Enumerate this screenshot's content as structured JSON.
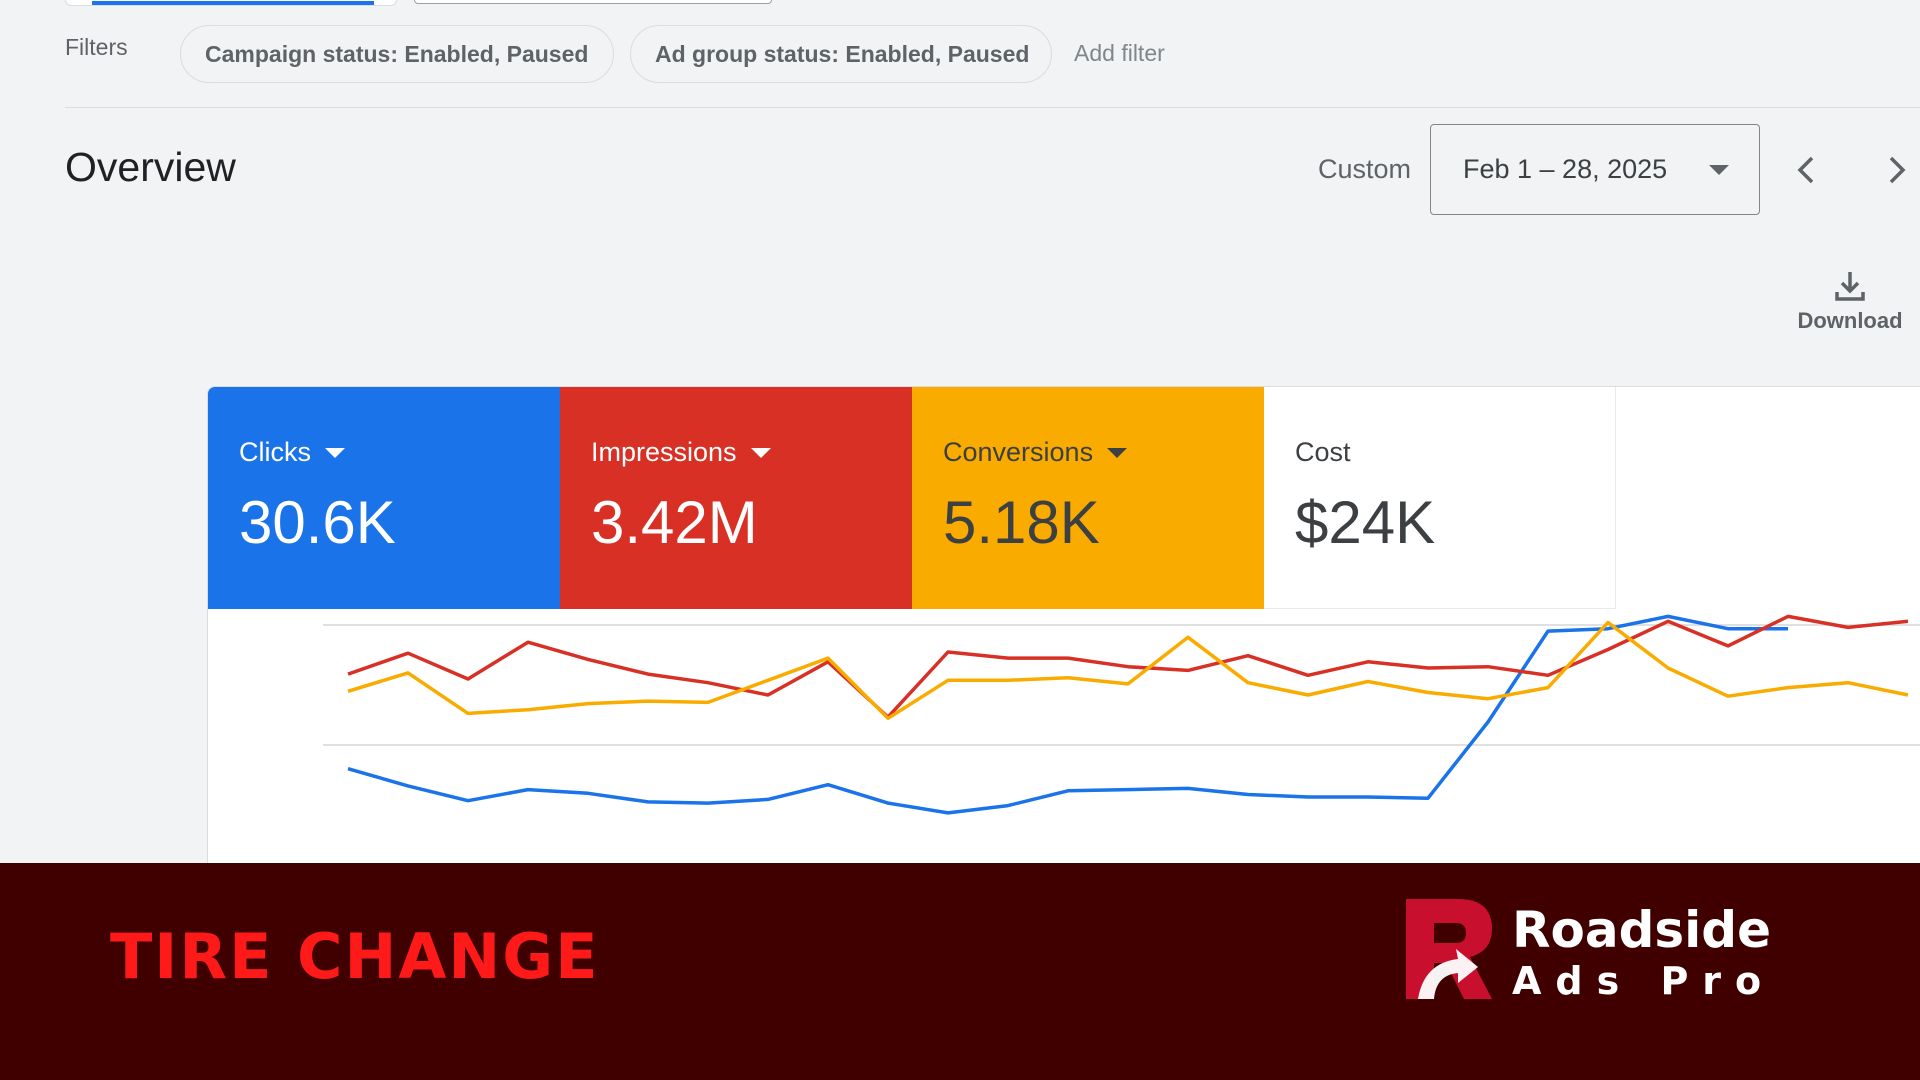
{
  "filters": {
    "label": "Filters",
    "chips": [
      "Campaign status: Enabled, Paused",
      "Ad group status: Enabled, Paused"
    ],
    "add_filter": "Add filter"
  },
  "overview": {
    "title": "Overview",
    "range_type": "Custom",
    "date_range": "Feb 1 – 28, 2025",
    "download_label": "Download"
  },
  "metrics": [
    {
      "label": "Clicks",
      "value": "30.6K",
      "color": "#1a73e8",
      "has_dropdown": true
    },
    {
      "label": "Impressions",
      "value": "3.42M",
      "color": "#d93025",
      "has_dropdown": true
    },
    {
      "label": "Conversions",
      "value": "5.18K",
      "color": "#f9ab00",
      "has_dropdown": true
    },
    {
      "label": "Cost",
      "value": "$24K",
      "color": "#ffffff",
      "has_dropdown": false
    }
  ],
  "chart_data": {
    "type": "line",
    "grid": true,
    "series": [
      {
        "name": "Clicks",
        "color": "#1a73e8",
        "values": [
          80,
          66,
          54,
          63,
          60,
          53,
          52,
          55,
          67,
          52,
          44,
          50,
          62,
          63,
          64,
          59,
          57,
          57,
          56,
          118,
          192,
          194,
          204,
          194,
          194
        ]
      },
      {
        "name": "Impressions",
        "color": "#d93025",
        "values": [
          157,
          174,
          153,
          183,
          169,
          157,
          150,
          140,
          167,
          122,
          175,
          170,
          170,
          163,
          160,
          172,
          156,
          167,
          162,
          163,
          156,
          177,
          200,
          180,
          204,
          195,
          200
        ]
      },
      {
        "name": "Conversions",
        "color": "#f9ab00",
        "values": [
          143,
          158,
          125,
          128,
          133,
          135,
          134,
          152,
          170,
          121,
          152,
          152,
          154,
          149,
          187,
          150,
          140,
          151,
          142,
          137,
          146,
          199,
          162,
          139,
          146,
          150,
          140
        ]
      }
    ]
  },
  "banner": {
    "title": "TIRE CHANGE",
    "brand_line1": "Roadside",
    "brand_line2": "Ads Pro",
    "bg_color": "#400000",
    "title_color": "#ff1a1a"
  }
}
